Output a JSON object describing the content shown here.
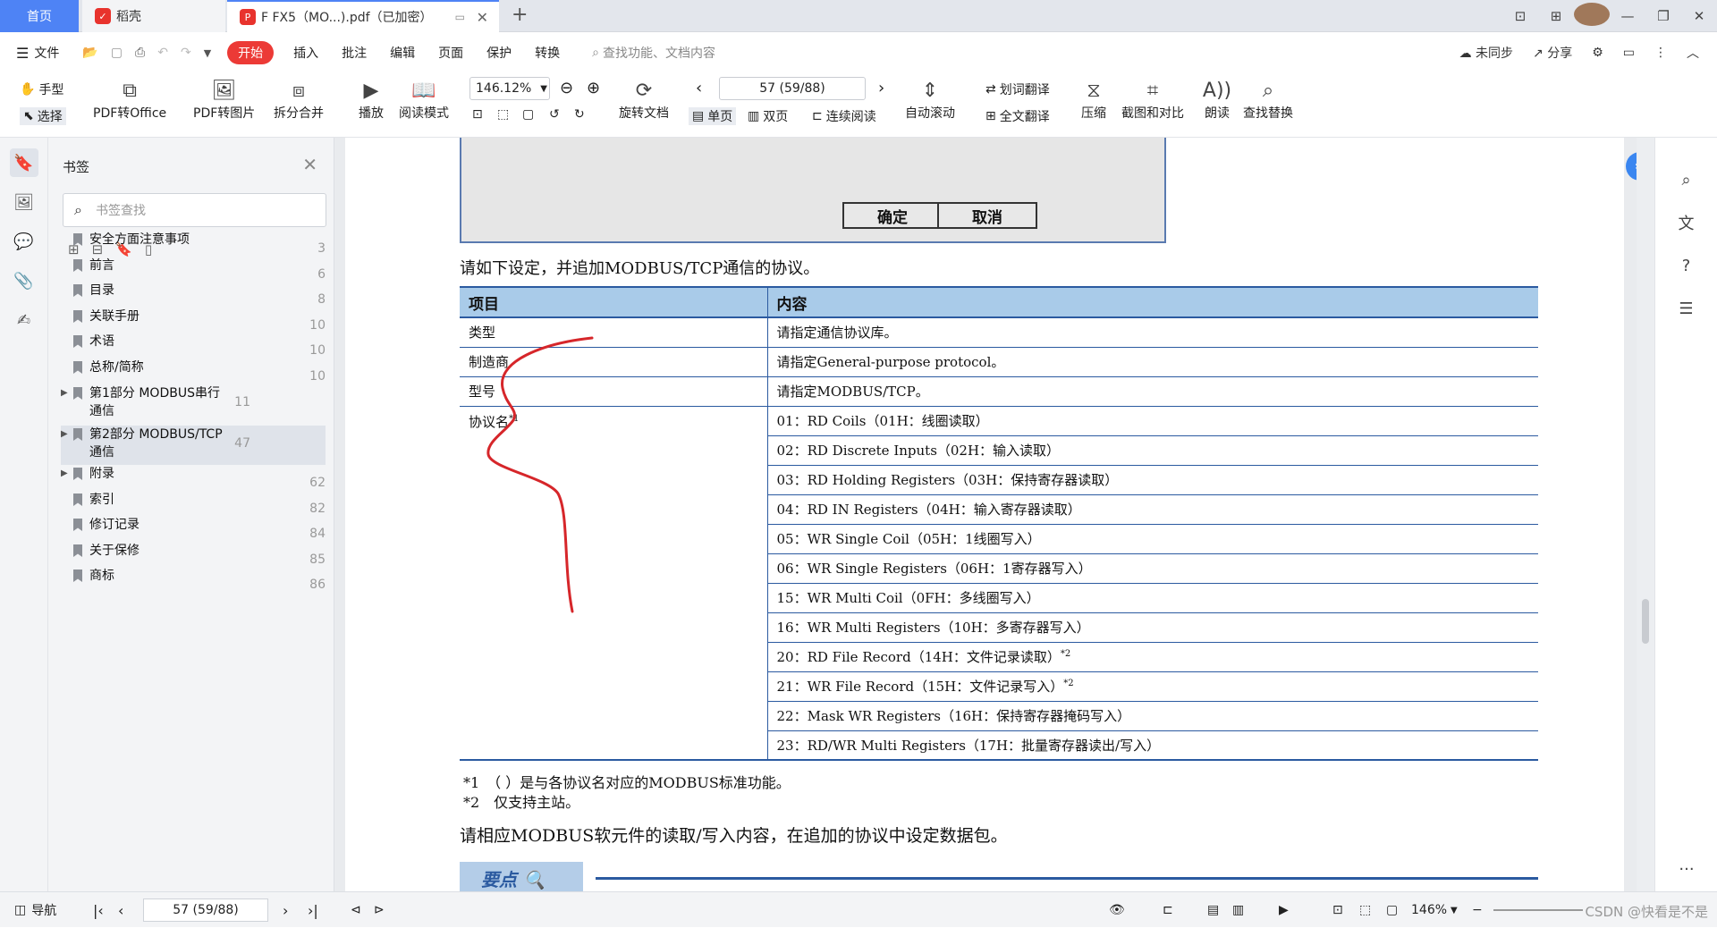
{
  "tabs": {
    "home": "首页",
    "daoke": "稻壳",
    "document": "F FX5（MO...).pdf（已加密）"
  },
  "menubar": {
    "file": "文件",
    "items": [
      "开始",
      "插入",
      "批注",
      "编辑",
      "页面",
      "保护",
      "转换"
    ],
    "search_placeholder": "查找功能、文档内容",
    "sync": "未同步",
    "share": "分享"
  },
  "toolbar": {
    "hand": "手型",
    "select": "选择",
    "pdf_to_office": "PDF转Office",
    "pdf_to_image": "PDF转图片",
    "split_merge": "拆分合并",
    "play": "播放",
    "read_mode": "阅读模式",
    "zoom": "146.12%",
    "rotate": "旋转文档",
    "page_display": "57 (59/88)",
    "single_page": "单页",
    "double_page": "双页",
    "continuous": "连续阅读",
    "auto_scroll": "自动滚动",
    "word_translate": "划词翻译",
    "full_translate": "全文翻译",
    "compress": "压缩",
    "screenshot_compare": "截图和对比",
    "read_aloud": "朗读",
    "find_replace": "查找替换"
  },
  "sidebar": {
    "title": "书签",
    "search_placeholder": "书签查找",
    "bookmarks": [
      {
        "label": "安全方面注意事项",
        "page": "3",
        "expandable": false
      },
      {
        "label": "前言",
        "page": "6",
        "expandable": false
      },
      {
        "label": "目录",
        "page": "8",
        "expandable": false
      },
      {
        "label": "关联手册",
        "page": "10",
        "expandable": false
      },
      {
        "label": "术语",
        "page": "10",
        "expandable": false
      },
      {
        "label": "总称/简称",
        "page": "10",
        "expandable": false
      },
      {
        "label": "第1部分 MODBUS串行通信",
        "page": "11",
        "expandable": true
      },
      {
        "label": "第2部分 MODBUS/TCP通信",
        "page": "47",
        "expandable": true
      },
      {
        "label": "附录",
        "page": "62",
        "expandable": true
      },
      {
        "label": "索引",
        "page": "82",
        "expandable": false
      },
      {
        "label": "修订记录",
        "page": "84",
        "expandable": false
      },
      {
        "label": "关于保修",
        "page": "85",
        "expandable": false
      },
      {
        "label": "商标",
        "page": "86",
        "expandable": false
      }
    ]
  },
  "document": {
    "dialog": {
      "ok": "确定",
      "cancel": "取消"
    },
    "intro": "请如下设定，并追加MODBUS/TCP通信的协议。",
    "table": {
      "headers": [
        "项目",
        "内容"
      ],
      "rows": [
        {
          "item": "类型",
          "content": "请指定通信协议库。"
        },
        {
          "item": "制造商",
          "content": "请指定General-purpose protocol。"
        },
        {
          "item": "型号",
          "content": "请指定MODBUS/TCP。"
        }
      ],
      "protocol_label": "协议名",
      "protocol_note": "*1",
      "protocols": [
        {
          "text": "01：RD Coils（01H：线圈读取）",
          "note": ""
        },
        {
          "text": "02：RD Discrete Inputs（02H：输入读取）",
          "note": ""
        },
        {
          "text": "03：RD Holding Registers（03H：保持寄存器读取）",
          "note": ""
        },
        {
          "text": "04：RD IN Registers（04H：输入寄存器读取）",
          "note": ""
        },
        {
          "text": "05：WR Single Coil（05H：1线圈写入）",
          "note": ""
        },
        {
          "text": "06：WR Single Registers（06H：1寄存器写入）",
          "note": ""
        },
        {
          "text": "15：WR Multi Coil（0FH：多线圈写入）",
          "note": ""
        },
        {
          "text": "16：WR Multi Registers（10H：多寄存器写入）",
          "note": ""
        },
        {
          "text": "20：RD File Record（14H：文件记录读取）",
          "note": "*2"
        },
        {
          "text": "21：WR File Record（15H：文件记录写入）",
          "note": "*2"
        },
        {
          "text": "22：Mask WR Registers（16H：保持寄存器掩码写入）",
          "note": ""
        },
        {
          "text": "23：RD/WR Multi Registers（17H：批量寄存器读出/写入）",
          "note": ""
        }
      ]
    },
    "footnote1": "*1　（ ）是与各协议名对应的MODBUS标准功能。",
    "footnote2": "*2　仅支持主站。",
    "paragraph": "请相应MODBUS软元件的读取/写入内容，在追加的协议中设定数据包。",
    "keypoint": "要点",
    "annotation_color": "#d6262a"
  },
  "statusbar": {
    "nav": "导航",
    "page": "57 (59/88)",
    "zoom": "146%",
    "watermark": "CSDN @快看是不是"
  },
  "colors": {
    "accent": "#4e83f5",
    "start_tab": "#ec3a36",
    "table_header": "#a9cbe9",
    "table_border": "#2b5aa0"
  }
}
